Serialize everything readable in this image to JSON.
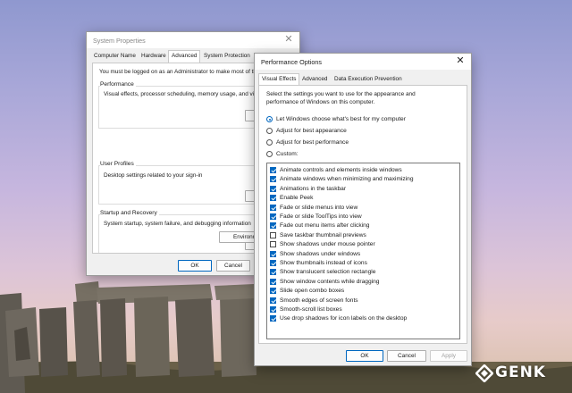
{
  "colors": {
    "accent": "#0067c0",
    "window_bg": "#f0f0f0",
    "panel_bg": "#ffffff"
  },
  "system_properties": {
    "title": "System Properties",
    "tabs": [
      {
        "label": "Computer Name"
      },
      {
        "label": "Hardware"
      },
      {
        "label": "Advanced",
        "active": true
      },
      {
        "label": "System Protection"
      },
      {
        "label": "R"
      }
    ],
    "admin_note": "You must be logged on as an Administrator to make most of the",
    "performance": {
      "title": "Performance",
      "description": "Visual effects, processor scheduling, memory usage, and virtu",
      "button": "Se"
    },
    "user_profiles": {
      "title": "User Profiles",
      "description": "Desktop settings related to your sign-in",
      "button": "Se"
    },
    "startup_recovery": {
      "title": "Startup and Recovery",
      "description": "System startup, system failure, and debugging information",
      "button": "Se"
    },
    "environment_button": "Environment",
    "ok": "OK",
    "cancel": "Cancel"
  },
  "performance_options": {
    "title": "Performance Options",
    "tabs": [
      {
        "label": "Visual Effects",
        "active": true
      },
      {
        "label": "Advanced"
      },
      {
        "label": "Data Execution Prevention"
      }
    ],
    "intro_line1": "Select the settings you want to use for the appearance and",
    "intro_line2": "performance of Windows on this computer.",
    "radios": [
      {
        "label": "Let Windows choose what's best for my computer",
        "selected": true
      },
      {
        "label": "Adjust for best appearance",
        "selected": false
      },
      {
        "label": "Adjust for best performance",
        "selected": false
      },
      {
        "label": "Custom:",
        "selected": false
      }
    ],
    "effects": [
      {
        "label": "Animate controls and elements inside windows",
        "checked": true
      },
      {
        "label": "Animate windows when minimizing and maximizing",
        "checked": true
      },
      {
        "label": "Animations in the taskbar",
        "checked": true
      },
      {
        "label": "Enable Peek",
        "checked": true
      },
      {
        "label": "Fade or slide menus into view",
        "checked": true
      },
      {
        "label": "Fade or slide ToolTips into view",
        "checked": true
      },
      {
        "label": "Fade out menu items after clicking",
        "checked": true
      },
      {
        "label": "Save taskbar thumbnail previews",
        "checked": false
      },
      {
        "label": "Show shadows under mouse pointer",
        "checked": false
      },
      {
        "label": "Show shadows under windows",
        "checked": true
      },
      {
        "label": "Show thumbnails instead of icons",
        "checked": true
      },
      {
        "label": "Show translucent selection rectangle",
        "checked": true
      },
      {
        "label": "Show window contents while dragging",
        "checked": true
      },
      {
        "label": "Slide open combo boxes",
        "checked": true
      },
      {
        "label": "Smooth edges of screen fonts",
        "checked": true
      },
      {
        "label": "Smooth-scroll list boxes",
        "checked": true
      },
      {
        "label": "Use drop shadows for icon labels on the desktop",
        "checked": true
      }
    ],
    "ok": "OK",
    "cancel": "Cancel",
    "apply": "Apply"
  },
  "watermark": {
    "text": "GENK",
    "icon": "genk-logo-icon"
  }
}
